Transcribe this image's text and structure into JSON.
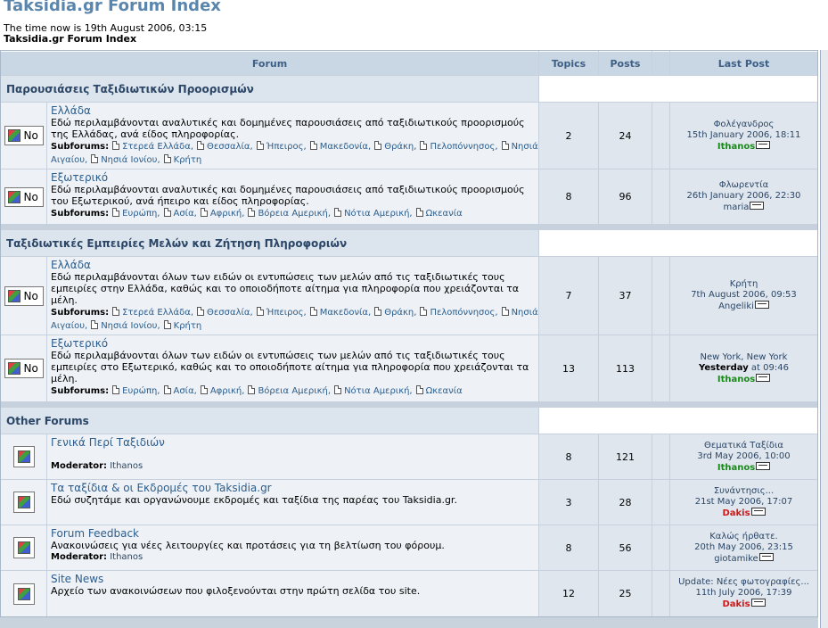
{
  "page": {
    "title": "Taksidia.gr Forum Index",
    "time_now": "The time now is 19th August 2006, 03:15",
    "index_link": "Taksidia.gr Forum Index"
  },
  "header": {
    "forum": "Forum",
    "topics": "Topics",
    "posts": "Posts",
    "last_post": "Last Post"
  },
  "labels": {
    "subforums": "Subforums:",
    "moderator": "Moderator:",
    "no_img": "No"
  },
  "categories": [
    {
      "name": "Παρουσιάσεις Ταξιδιωτικών Προορισμών"
    },
    {
      "name": "Ταξιδιωτικές Εμπειρίες Μελών και Ζήτηση Πληροφοριών"
    },
    {
      "name": "Other Forums"
    }
  ],
  "forums": [
    {
      "name": "Ελλάδα",
      "desc": "Εδώ περιλαμβάνονται αναλυτικές και δομημένες παρουσιάσεις από ταξιδιωτικούς προορισμούς της Ελλάδας, ανά είδος πληροφορίας.",
      "subforums": [
        "Στερεά Ελλάδα,",
        "Θεσσαλία,",
        "Ήπειρος,",
        "Μακεδονία,",
        "Θράκη,",
        "Πελοπόννησος,",
        "Νησιά Αιγαίου,",
        "Νησιά Ιονίου,",
        "Κρήτη"
      ],
      "topics": "2",
      "posts": "24",
      "last_title": "Φολέγανδρος",
      "last_date": "15th January 2006, 18:11",
      "last_user": "Ithanos"
    },
    {
      "name": "Εξωτερικό",
      "desc": "Εδώ περιλαμβάνονται αναλυτικές και δομημένες παρουσιάσεις από ταξιδιωτικούς προορισμούς του Εξωτερικού, ανά ήπειρο και είδος πληροφορίας.",
      "subforums": [
        "Ευρώπη,",
        "Ασία,",
        "Αφρική,",
        "Βόρεια Αμερική,",
        "Νότια Αμερική,",
        "Ωκεανία"
      ],
      "topics": "8",
      "posts": "96",
      "last_title": "Φλωρεντία",
      "last_date": "26th January 2006, 22:30",
      "last_user": "maria"
    },
    {
      "name": "Ελλάδα",
      "desc": "Εδώ περιλαμβάνονται όλων των ειδών οι εντυπώσεις των μελών από τις ταξιδιωτικές τους εμπειρίες στην Ελλάδα, καθώς και το οποιοδήποτε αίτημα για πληροφορία που χρειάζονται τα μέλη.",
      "subforums": [
        "Στερεά Ελλάδα,",
        "Θεσσαλία,",
        "Ήπειρος,",
        "Μακεδονία,",
        "Θράκη,",
        "Πελοπόννησος,",
        "Νησιά Αιγαίου,",
        "Νησιά Ιονίου,",
        "Κρήτη"
      ],
      "topics": "7",
      "posts": "37",
      "last_title": "Κρήτη",
      "last_date": "7th August 2006, 09:53",
      "last_user": "Angeliki"
    },
    {
      "name": "Εξωτερικό",
      "desc": "Εδώ περιλαμβάνονται όλων των ειδών οι εντυπώσεις των μελών από τις ταξιδιωτικές τους εμπειρίες στο Εξωτερικό, καθώς και το οποιοδήποτε αίτημα για πληροφορία που χρειάζονται τα μέλη.",
      "subforums": [
        "Ευρώπη,",
        "Ασία,",
        "Αφρική,",
        "Βόρεια Αμερική,",
        "Νότια Αμερική,",
        "Ωκεανία"
      ],
      "topics": "13",
      "posts": "113",
      "last_title": "New York, New York",
      "last_date_bold": "Yesterday",
      "last_date": "at 09:46",
      "last_user": "Ithanos"
    },
    {
      "name": "Γενικά Περί Ταξιδιών",
      "desc": "",
      "moderator": "Ithanos",
      "topics": "8",
      "posts": "121",
      "last_title": "Θεματικά Ταξίδια",
      "last_date": "3rd May 2006, 10:00",
      "last_user": "Ithanos"
    },
    {
      "name": "Τα ταξίδια & οι Εκδρομές του Taksidia.gr",
      "desc": "Εδώ συζητάμε και οργανώνουμε εκδρομές και ταξίδια της παρέας του Taksidia.gr.",
      "topics": "3",
      "posts": "28",
      "last_title": "Συνάντησις...",
      "last_date": "21st May 2006, 17:07",
      "last_user": "Dakis"
    },
    {
      "name": "Forum Feedback",
      "desc": "Ανακοινώσεις για νέες λειτουργίες και προτάσεις για τη βελτίωση του φόρουμ.",
      "moderator": "Ithanos",
      "topics": "8",
      "posts": "56",
      "last_title": "Καλώς ήρθατε.",
      "last_date": "20th May 2006, 23:15",
      "last_user": "giotamike"
    },
    {
      "name": "Site News",
      "desc": "Αρχείο των ανακοινώσεων που φιλοξενούνται στην πρώτη σελίδα του site.",
      "topics": "12",
      "posts": "25",
      "last_title": "Update: Νέες φωτογραφίες...",
      "last_date": "11th July 2006, 17:39",
      "last_user": "Dakis"
    }
  ]
}
